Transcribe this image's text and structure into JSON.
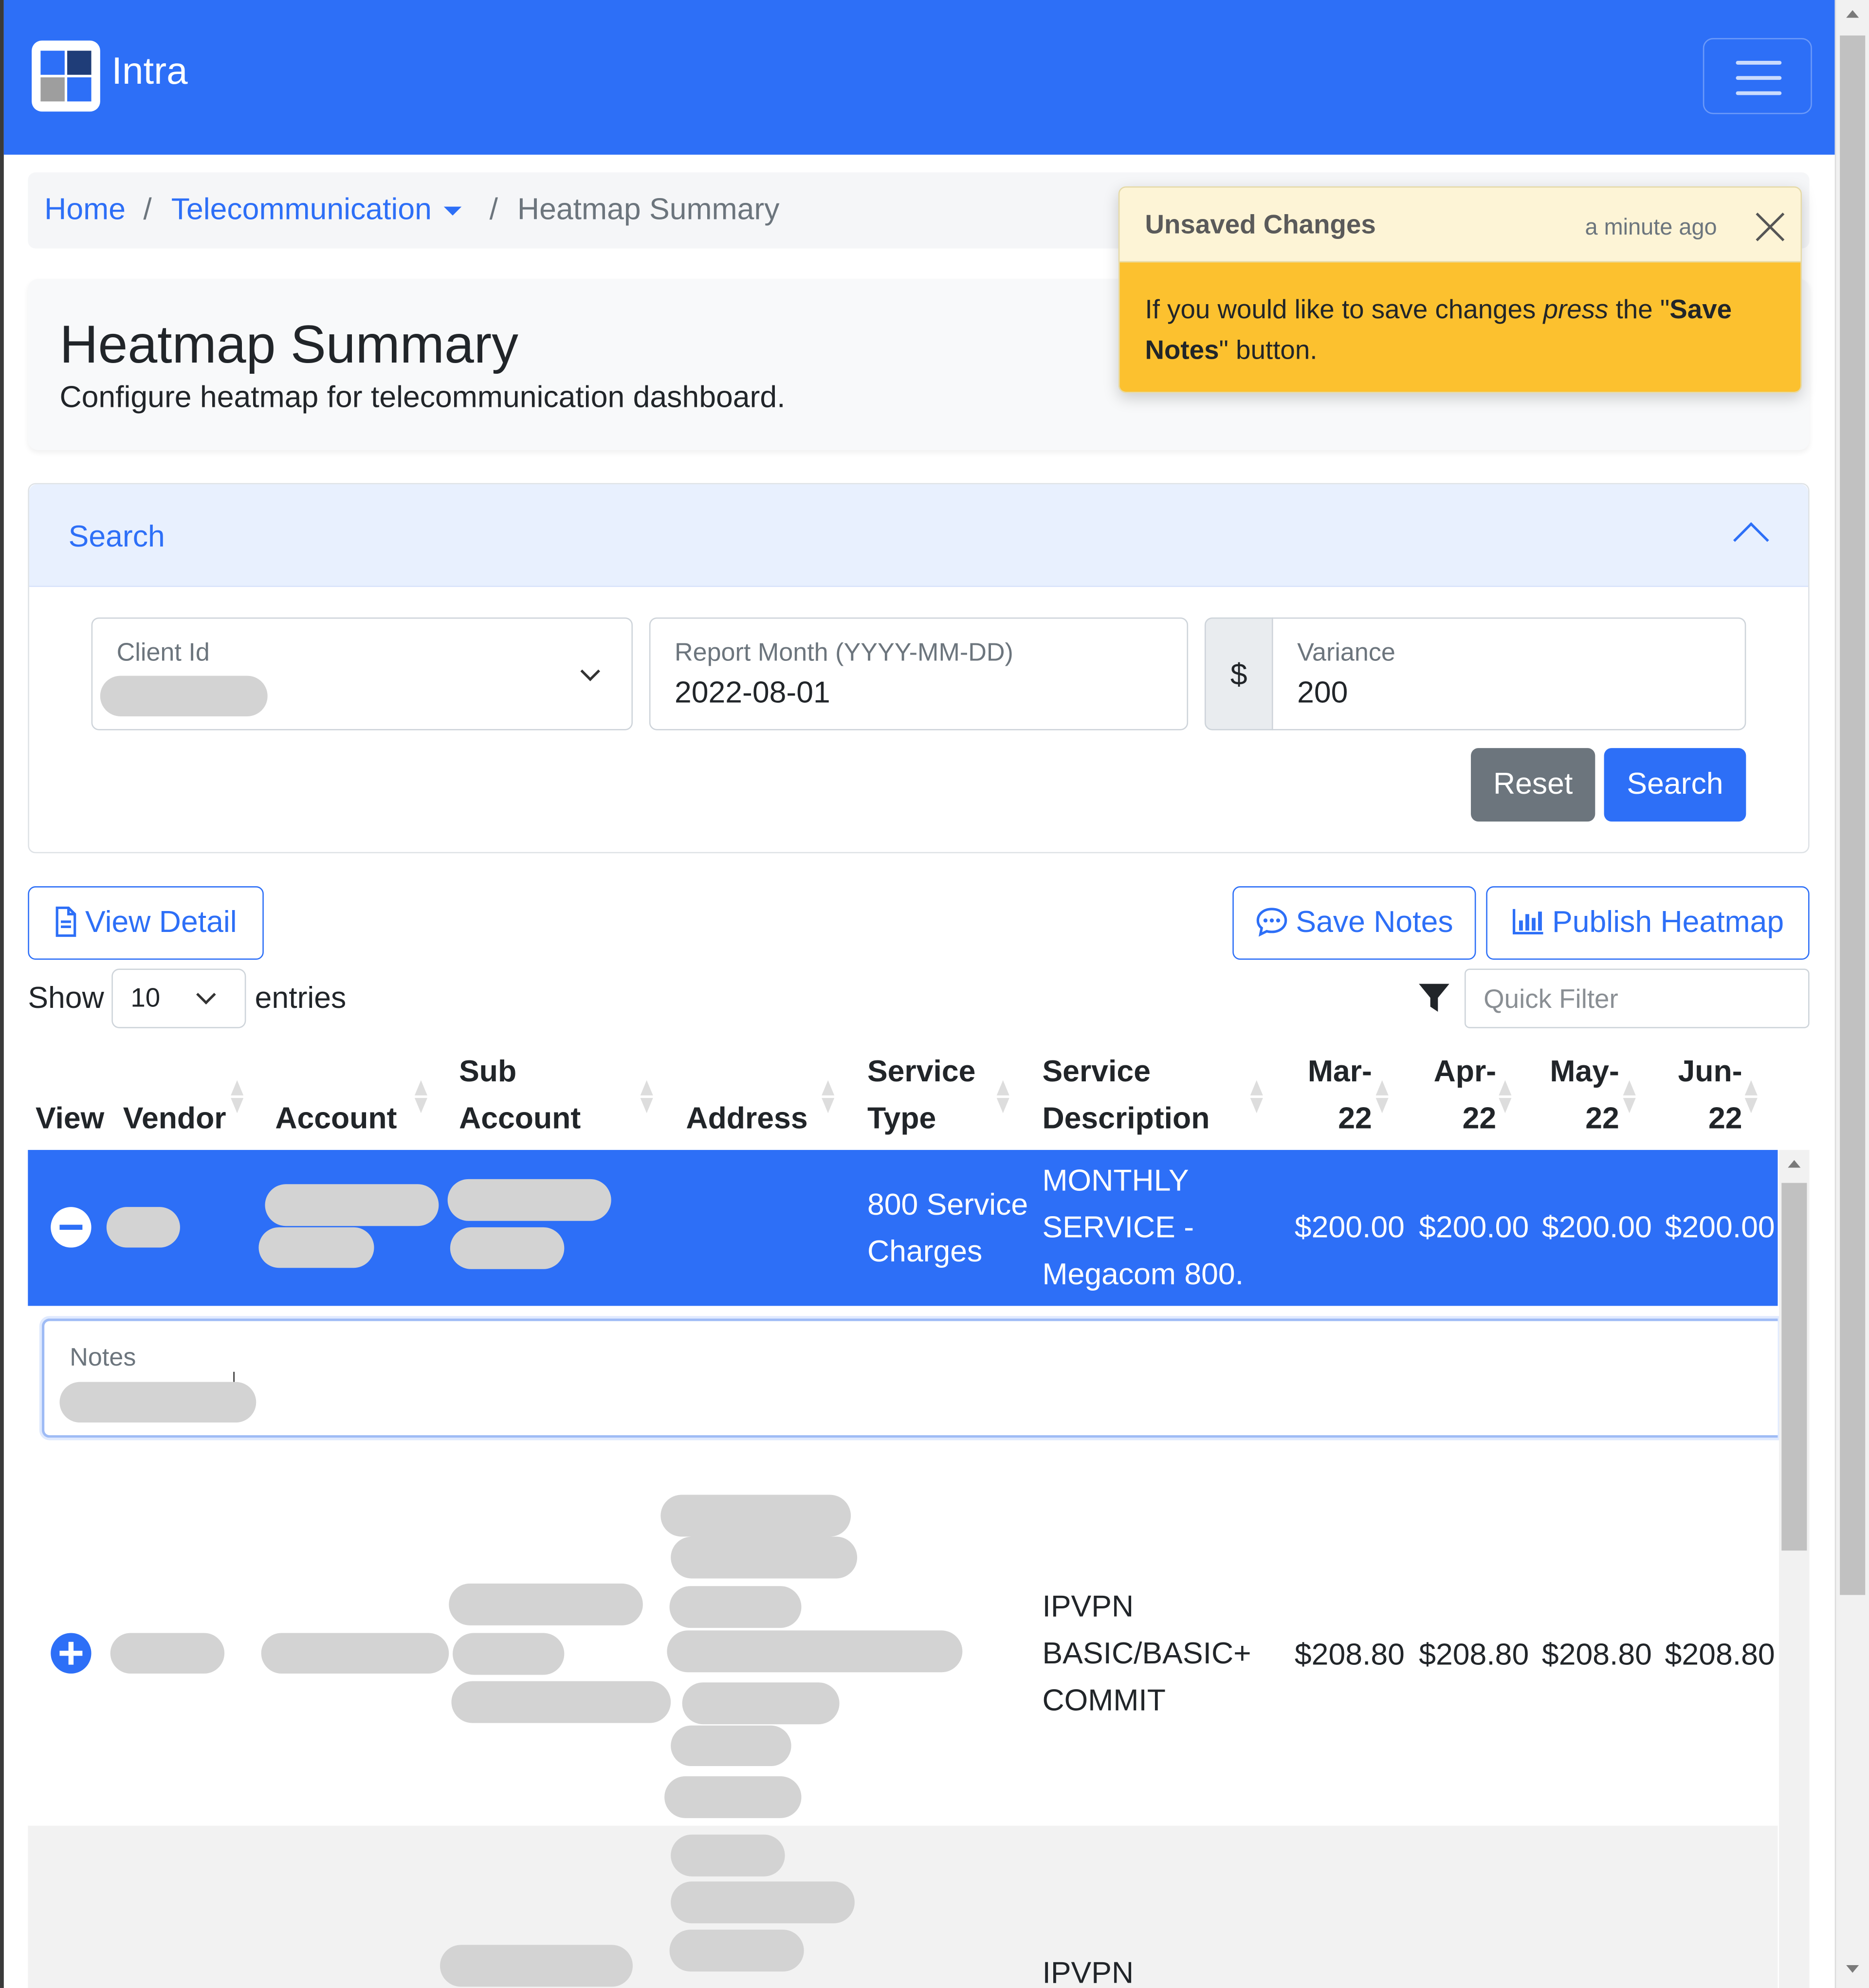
{
  "app": {
    "brand": "Intra"
  },
  "breadcrumb": {
    "home": "Home",
    "section": "Telecommunication",
    "sep": "/",
    "current": "Heatmap Summary"
  },
  "header": {
    "title": "Heatmap Summary",
    "subtitle": "Configure heatmap for telecommunication dashboard."
  },
  "toast": {
    "title": "Unsaved Changes",
    "time": "a minute ago",
    "body_1": "If you would like to save changes ",
    "body_em": "press",
    "body_2": " the \"",
    "body_strong": "Save Notes",
    "body_3": "\" button."
  },
  "search": {
    "title": "Search",
    "client_label": "Client Id",
    "month_label": "Report Month (YYYY-MM-DD)",
    "month_value": "2022-08-01",
    "currency_symbol": "$",
    "variance_label": "Variance",
    "variance_value": "200",
    "reset_label": "Reset",
    "search_label": "Search"
  },
  "toolbar": {
    "view_detail": "View Detail",
    "save_notes": "Save Notes",
    "publish_heatmap": "Publish Heatmap",
    "show": "Show",
    "entries_value": "10",
    "entries": "entries",
    "quick_filter_placeholder": "Quick Filter"
  },
  "table": {
    "headers": {
      "view": "View",
      "vendor": "Vendor",
      "account": "Account",
      "sub_account_1": "Sub",
      "sub_account_2": "Account",
      "address": "Address",
      "service_type_1": "Service",
      "service_type_2": "Type",
      "service_desc_1": "Service",
      "service_desc_2": "Description",
      "m1_1": "Mar-",
      "m1_2": "22",
      "m2_1": "Apr-",
      "m2_2": "22",
      "m3_1": "May-",
      "m3_2": "22",
      "m4_1": "Jun-",
      "m4_2": "22"
    },
    "rows": [
      {
        "service_type_1": "800 Service",
        "service_type_2": "Charges",
        "desc_1": "MONTHLY",
        "desc_2": "SERVICE -",
        "desc_3": "Megacom 800.",
        "m1": "$200.00",
        "m2": "$200.00",
        "m3": "$200.00",
        "m4": "$200.00",
        "notes_label": "Notes"
      },
      {
        "desc_1": "IPVPN",
        "desc_2": "BASIC/BASIC+",
        "desc_3": "COMMIT",
        "m1": "$208.80",
        "m2": "$208.80",
        "m3": "$208.80",
        "m4": "$208.80"
      },
      {
        "desc_1": "IPVPN"
      }
    ]
  },
  "colors": {
    "primary": "#2d6ff7",
    "warning": "#fcc12f",
    "secondary": "#6c757d",
    "redaction": "#d3d3d3"
  }
}
